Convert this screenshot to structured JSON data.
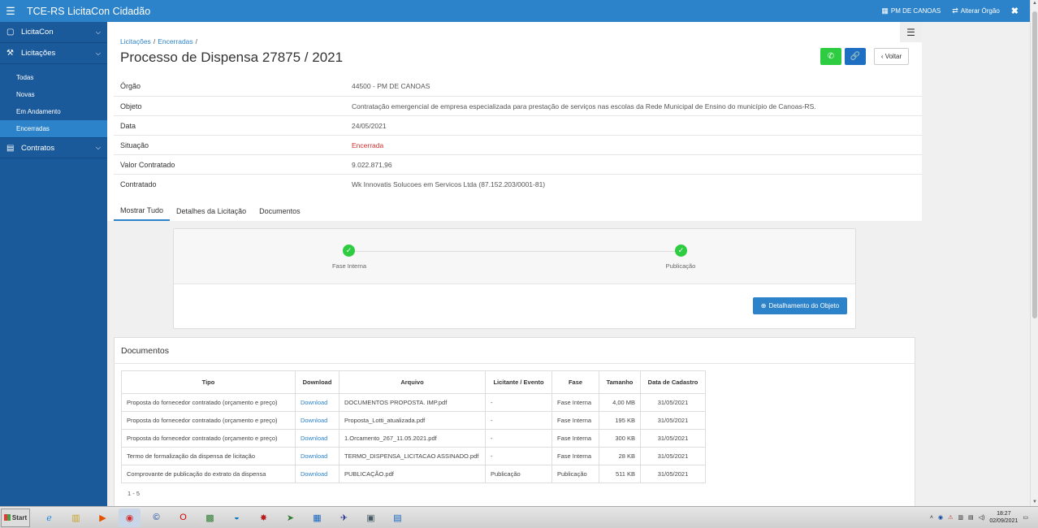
{
  "topbar": {
    "title": "TCE-RS LicitaCon Cidadão",
    "org_label": "PM DE CANOAS",
    "change_org_label": "Alterar Órgão",
    "close_glyph": "✖"
  },
  "sidebar": {
    "licitacon": "LicitaCon",
    "licitacoes": "Licitações",
    "sub": [
      "Todas",
      "Novas",
      "Em Andamento",
      "Encerradas"
    ],
    "contratos": "Contratos"
  },
  "breadcrumb": {
    "first": "Licitações",
    "second": "Encerradas"
  },
  "page_title": "Processo de Dispensa 27875 / 2021",
  "buttons": {
    "back": "‹ Voltar",
    "detail": "Detalhamento do Objeto"
  },
  "info": [
    {
      "label": "Órgão",
      "value": "44500 - PM DE CANOAS"
    },
    {
      "label": "Objeto",
      "value": "Contratação emergencial de empresa especializada para prestação de serviços nas escolas da Rede Municipal de Ensino do município de Canoas-RS."
    },
    {
      "label": "Data",
      "value": "24/05/2021"
    },
    {
      "label": "Situação",
      "value": "Encerrada"
    },
    {
      "label": "Valor Contratado",
      "value": "9.022.871,96"
    },
    {
      "label": "Contratado",
      "value": "Wk Innovatis Solucoes em Servicos Ltda (87.152.203/0001-81)"
    }
  ],
  "tabs": [
    "Mostrar Tudo",
    "Detalhes da Licitação",
    "Documentos"
  ],
  "steps": [
    "Fase Interna",
    "Publicação"
  ],
  "documents": {
    "title": "Documentos",
    "headers": [
      "Tipo",
      "Download",
      "Arquivo",
      "Licitante / Evento",
      "Fase",
      "Tamanho",
      "Data de Cadastro"
    ],
    "rows": [
      [
        "Proposta do fornecedor contratado (orçamento e preço)",
        "Download",
        "DOCUMENTOS PROPOSTA. IMP.pdf",
        "-",
        "Fase Interna",
        "4,00 MB",
        "31/05/2021"
      ],
      [
        "Proposta do fornecedor contratado (orçamento e preço)",
        "Download",
        "Proposta_Lotti_atualizada.pdf",
        "-",
        "Fase Interna",
        "195 KB",
        "31/05/2021"
      ],
      [
        "Proposta do fornecedor contratado (orçamento e preço)",
        "Download",
        "1.Orcamento_267_11.05.2021.pdf",
        "-",
        "Fase Interna",
        "300 KB",
        "31/05/2021"
      ],
      [
        "Termo de formalização da dispensa de licitação",
        "Download",
        "TERMO_DISPENSA_LICITACAO ASSINADO.pdf",
        "-",
        "Fase Interna",
        "28 KB",
        "31/05/2021"
      ],
      [
        "Comprovante de publicação do extrato da dispensa",
        "Download",
        "PUBLICAÇÃO.pdf",
        "Publicação",
        "Publicação",
        "511 KB",
        "31/05/2021"
      ]
    ],
    "pager": "1 - 5"
  },
  "taskbar": {
    "start": "Start",
    "time": "18:27",
    "date": "02/09/2021"
  },
  "colors": {
    "primary": "#2d83c9",
    "sidebar": "#1a5a9b",
    "success": "#2ecc40",
    "danger": "#d32f2f"
  }
}
